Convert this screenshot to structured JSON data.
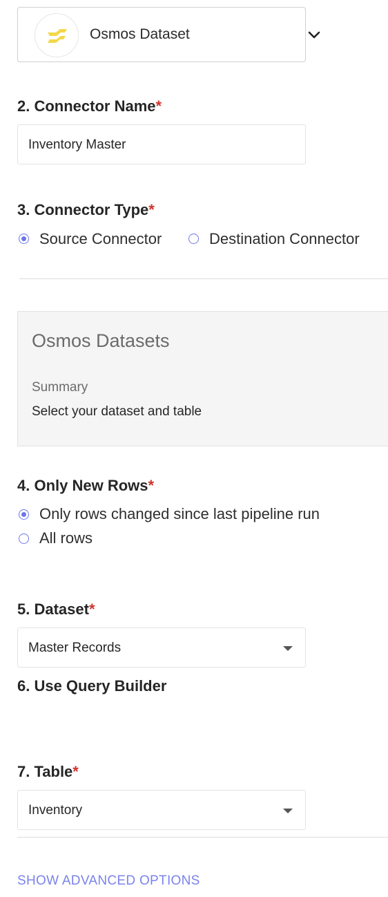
{
  "connector": {
    "selected_name": "Osmos Dataset",
    "logo_icon": "osmos-logo-icon",
    "logo_color": "#f2d84a"
  },
  "connector_name": {
    "label": "2. Connector Name",
    "required_mark": "*",
    "value": "Inventory Master"
  },
  "connector_type": {
    "label": "3. Connector Type",
    "required_mark": "*",
    "options": [
      "Source Connector",
      "Destination Connector"
    ],
    "selected_index": 0
  },
  "info": {
    "title": "Osmos Datasets",
    "summary_label": "Summary",
    "summary_text": "Select your dataset and table"
  },
  "only_new_rows": {
    "label": "4. Only New Rows",
    "required_mark": "*",
    "options": [
      "Only rows changed since last pipeline run",
      "All rows"
    ],
    "selected_index": 0
  },
  "dataset": {
    "label": "5. Dataset",
    "required_mark": "*",
    "value": "Master Records"
  },
  "query_builder": {
    "label": "6. Use Query Builder"
  },
  "table": {
    "label": "7. Table",
    "required_mark": "*",
    "value": "Inventory"
  },
  "advanced": {
    "label": "SHOW ADVANCED OPTIONS"
  },
  "colors": {
    "accent": "#7b83eb",
    "required": "#d0342c"
  }
}
